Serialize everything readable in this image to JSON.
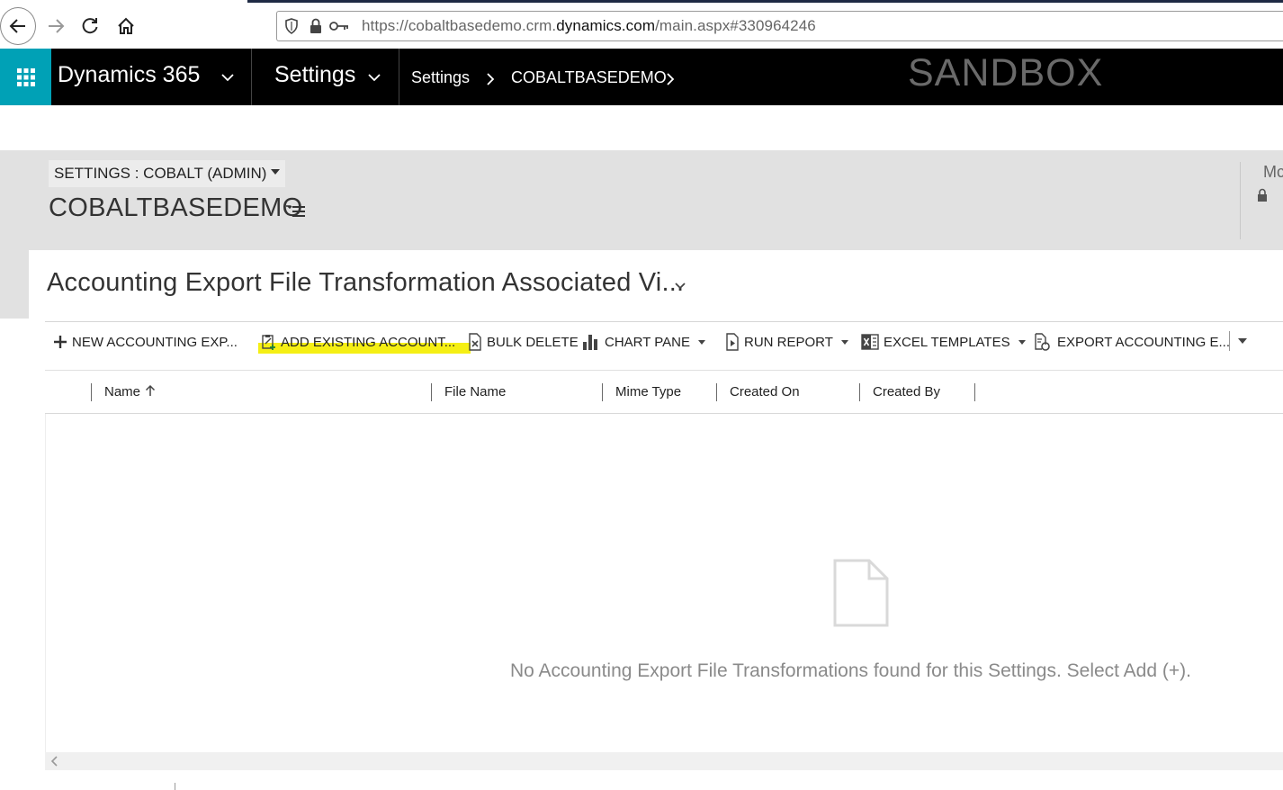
{
  "browser": {
    "url_prefix": "https://cobaltbasedemo.crm.",
    "url_domain": "dynamics.com",
    "url_suffix": "/main.aspx#330964246"
  },
  "topnav": {
    "product": "Dynamics 365",
    "area": "Settings",
    "breadcrumb": [
      "Settings",
      "COBALTBASEDEMO"
    ],
    "environment_label": "SANDBOX",
    "launcher_color": "#00a1b6"
  },
  "header": {
    "selector_label": "SETTINGS : COBALT (ADMIN)",
    "record_title": "COBALTBASEDEMO",
    "right_label": "Mc"
  },
  "view": {
    "title": "Accounting Export File Transformation Associated Vi..."
  },
  "commands": {
    "new": "NEW ACCOUNTING EXP...",
    "add_existing": "ADD EXISTING ACCOUNT...",
    "bulk_delete": "BULK DELETE",
    "chart_pane": "CHART PANE",
    "run_report": "RUN REPORT",
    "excel_templates": "EXCEL TEMPLATES",
    "export_accounting": "EXPORT ACCOUNTING E...",
    "highlight_color": "#f5ef14"
  },
  "grid": {
    "columns": [
      {
        "label": "Name",
        "sorted": "ascending"
      },
      {
        "label": "File Name"
      },
      {
        "label": "Mime Type"
      },
      {
        "label": "Created On"
      },
      {
        "label": "Created By"
      }
    ],
    "empty_message": "No Accounting Export File Transformations found for this Settings. Select Add (+)."
  }
}
